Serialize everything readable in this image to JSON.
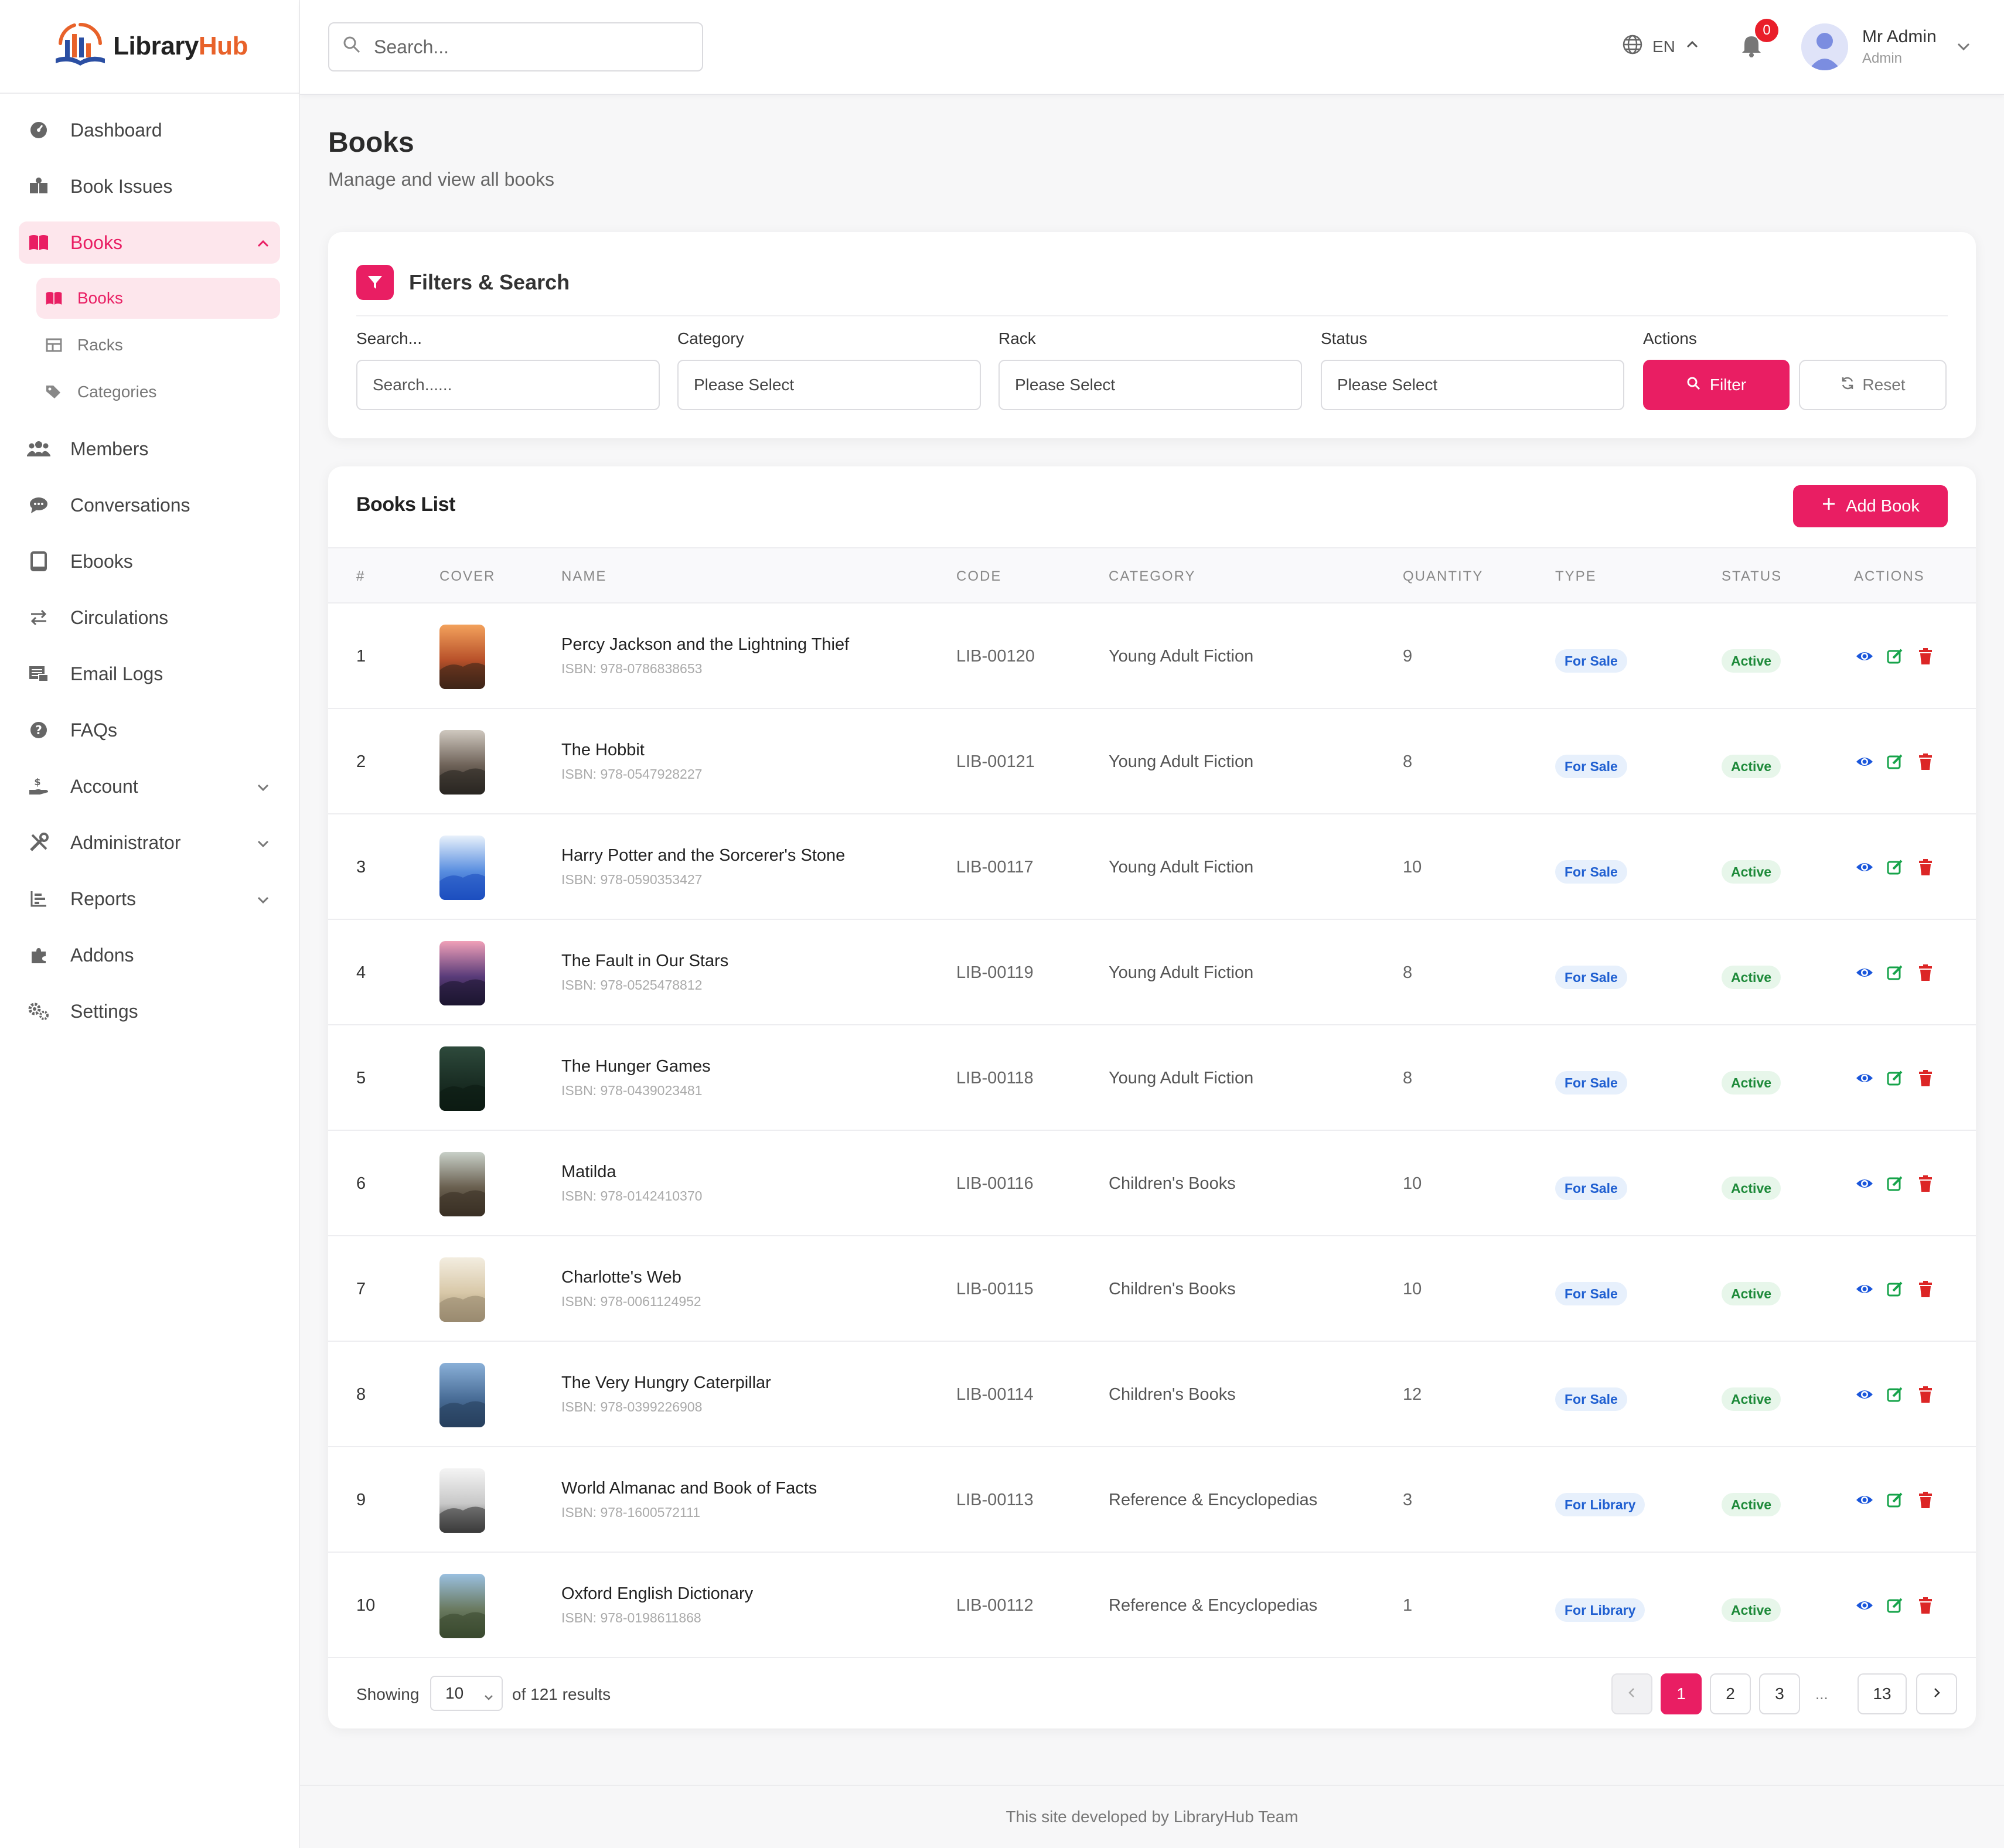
{
  "brand": {
    "name_a": "Library",
    "name_b": "Hub"
  },
  "search": {
    "placeholder": "Search..."
  },
  "header": {
    "language": "EN",
    "notification_count": "0",
    "user_name": "Mr Admin",
    "user_role": "Admin"
  },
  "sidebar": {
    "items": [
      {
        "label": "Dashboard",
        "icon": "dashboard-icon"
      },
      {
        "label": "Book Issues",
        "icon": "book-issues-icon"
      },
      {
        "label": "Books",
        "icon": "book-open-icon",
        "expanded": true
      },
      {
        "label": "Members",
        "icon": "users-icon"
      },
      {
        "label": "Conversations",
        "icon": "chat-icon"
      },
      {
        "label": "Ebooks",
        "icon": "tablet-icon"
      },
      {
        "label": "Circulations",
        "icon": "exchange-icon"
      },
      {
        "label": "Email Logs",
        "icon": "mail-log-icon"
      },
      {
        "label": "FAQs",
        "icon": "question-icon"
      },
      {
        "label": "Account",
        "icon": "hand-coin-icon"
      },
      {
        "label": "Administrator",
        "icon": "tools-icon"
      },
      {
        "label": "Reports",
        "icon": "chart-icon"
      },
      {
        "label": "Addons",
        "icon": "puzzle-icon"
      },
      {
        "label": "Settings",
        "icon": "gears-icon"
      }
    ],
    "sub_items": [
      {
        "label": "Books",
        "icon": "book-open-icon"
      },
      {
        "label": "Racks",
        "icon": "table-icon"
      },
      {
        "label": "Categories",
        "icon": "tags-icon"
      }
    ]
  },
  "page": {
    "title": "Books",
    "subtitle": "Manage and view all books"
  },
  "filters": {
    "title": "Filters & Search",
    "search_label": "Search...",
    "search_placeholder": "Search......",
    "category_label": "Category",
    "category_value": "Please Select",
    "rack_label": "Rack",
    "rack_value": "Please Select",
    "status_label": "Status",
    "status_value": "Please Select",
    "actions_label": "Actions",
    "filter_button": "Filter",
    "reset_button": "Reset"
  },
  "list": {
    "title": "Books List",
    "add_button": "Add Book",
    "columns": [
      "#",
      "COVER",
      "NAME",
      "CODE",
      "CATEGORY",
      "QUANTITY",
      "TYPE",
      "STATUS",
      "ACTIONS"
    ],
    "rows": [
      {
        "index": "1",
        "name": "Percy Jackson and the Lightning Thief",
        "isbn": "ISBN: 978-0786838653",
        "code": "LIB-00120",
        "category": "Young Adult Fiction",
        "quantity": "9",
        "type": "For Sale",
        "status": "Active"
      },
      {
        "index": "2",
        "name": "The Hobbit",
        "isbn": "ISBN: 978-0547928227",
        "code": "LIB-00121",
        "category": "Young Adult Fiction",
        "quantity": "8",
        "type": "For Sale",
        "status": "Active"
      },
      {
        "index": "3",
        "name": "Harry Potter and the Sorcerer's Stone",
        "isbn": "ISBN: 978-0590353427",
        "code": "LIB-00117",
        "category": "Young Adult Fiction",
        "quantity": "10",
        "type": "For Sale",
        "status": "Active"
      },
      {
        "index": "4",
        "name": "The Fault in Our Stars",
        "isbn": "ISBN: 978-0525478812",
        "code": "LIB-00119",
        "category": "Young Adult Fiction",
        "quantity": "8",
        "type": "For Sale",
        "status": "Active"
      },
      {
        "index": "5",
        "name": "The Hunger Games",
        "isbn": "ISBN: 978-0439023481",
        "code": "LIB-00118",
        "category": "Young Adult Fiction",
        "quantity": "8",
        "type": "For Sale",
        "status": "Active"
      },
      {
        "index": "6",
        "name": "Matilda",
        "isbn": "ISBN: 978-0142410370",
        "code": "LIB-00116",
        "category": "Children's Books",
        "quantity": "10",
        "type": "For Sale",
        "status": "Active"
      },
      {
        "index": "7",
        "name": "Charlotte's Web",
        "isbn": "ISBN: 978-0061124952",
        "code": "LIB-00115",
        "category": "Children's Books",
        "quantity": "10",
        "type": "For Sale",
        "status": "Active"
      },
      {
        "index": "8",
        "name": "The Very Hungry Caterpillar",
        "isbn": "ISBN: 978-0399226908",
        "code": "LIB-00114",
        "category": "Children's Books",
        "quantity": "12",
        "type": "For Sale",
        "status": "Active"
      },
      {
        "index": "9",
        "name": "World Almanac and Book of Facts",
        "isbn": "ISBN: 978-1600572111",
        "code": "LIB-00113",
        "category": "Reference & Encyclopedias",
        "quantity": "3",
        "type": "For Library",
        "status": "Active"
      },
      {
        "index": "10",
        "name": "Oxford English Dictionary",
        "isbn": "ISBN: 978-0198611868",
        "code": "LIB-00112",
        "category": "Reference & Encyclopedias",
        "quantity": "1",
        "type": "For Library",
        "status": "Active"
      }
    ]
  },
  "pagination": {
    "showing_label": "Showing",
    "per_page": "10",
    "results_text": "of 121 results",
    "pages": [
      "1",
      "2",
      "3"
    ],
    "ellipsis": "...",
    "last_page": "13",
    "current_page": "1"
  },
  "footer": {
    "text": "This site developed by LibraryHub Team"
  },
  "colors": {
    "accent": "#e91e63",
    "type_badge": "#1f5fd1",
    "status_active": "#1e8a3a",
    "view": "#1a56db",
    "edit": "#16a34a",
    "delete": "#dc2626"
  }
}
